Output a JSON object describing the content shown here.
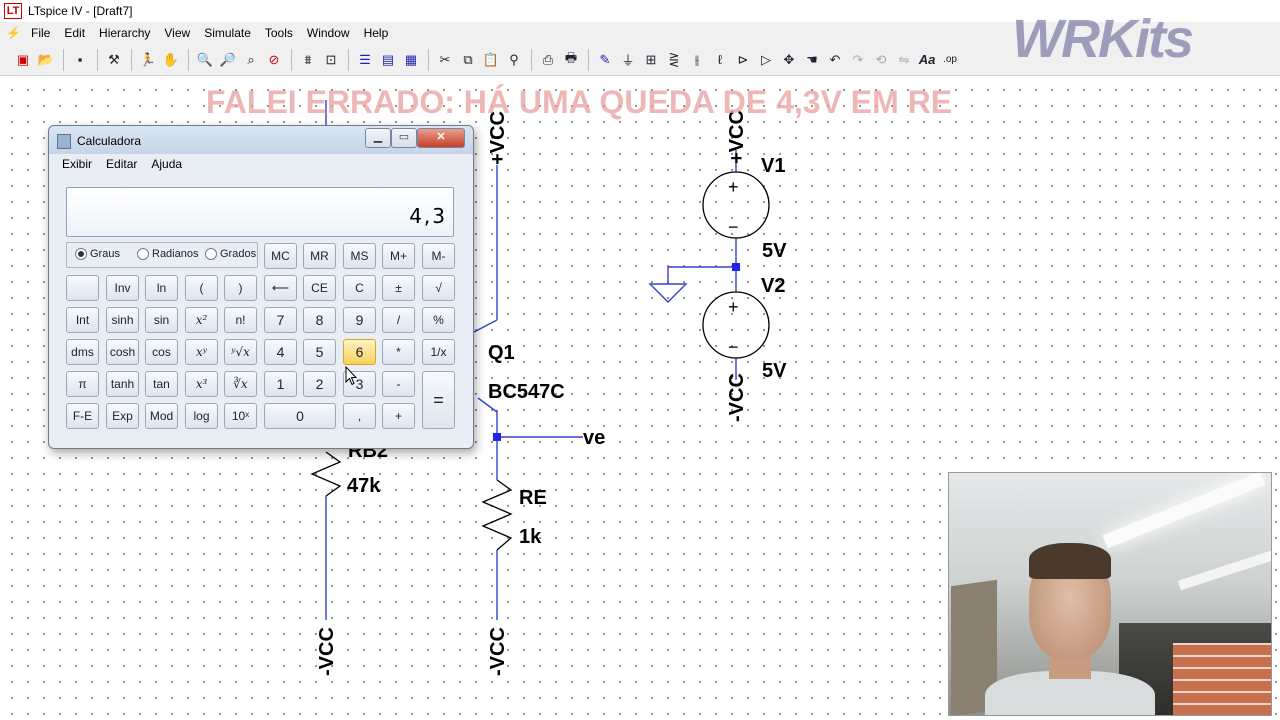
{
  "window": {
    "title": "LTspice IV - [Draft7]",
    "app_icon": "LT"
  },
  "menu": [
    "File",
    "Edit",
    "Hierarchy",
    "View",
    "Simulate",
    "Tools",
    "Window",
    "Help"
  ],
  "toolbar_icons": [
    "new-schematic-icon",
    "open-icon",
    "save-icon",
    "control-panel-icon",
    "run-icon",
    "halt-icon",
    "zoom-in-icon",
    "zoom-out-icon",
    "zoom-fit-icon",
    "zoom-cancel-icon",
    "autorange-icon",
    "tile-icon",
    "horizontal-tile-icon",
    "vertical-tile-icon",
    "cascade-icon",
    "cut-icon",
    "copy-icon",
    "paste-icon",
    "find-icon",
    "print-setup-icon",
    "print-icon",
    "draw-wire-icon",
    "ground-icon",
    "label-net-icon",
    "resistor-icon",
    "capacitor-icon",
    "inductor-icon",
    "diode-icon",
    "component-icon",
    "move-icon",
    "drag-icon",
    "undo-icon",
    "redo-icon",
    "rotate-icon",
    "mirror-icon",
    "text-icon",
    "spice-directive-icon"
  ],
  "watermark": "WRKits",
  "banner": "FALEI ERRADO: HÁ UMA QUEDA DE 4,3V EM RE",
  "schematic": {
    "labels": {
      "vcc_top": "+VCC",
      "vcc_v1": "+VCC",
      "v1": "V1",
      "v1_value": "5V",
      "v2": "V2",
      "v2_value": "5V",
      "vcc_v2": "-VCC",
      "q1": "Q1",
      "q1_model": "BC547C",
      "ve": "ve",
      "rb2": "RB2",
      "rb2_value": "47k",
      "re": "RE",
      "re_value": "1k",
      "vee_left": "-VCC",
      "vee_right": "-VCC",
      "plus": "+",
      "minus": "−"
    },
    "colors": {
      "wire": "#3344cc",
      "node": "#2222ee",
      "component": "#000000"
    }
  },
  "calculator": {
    "title": "Calculadora",
    "menu": [
      "Exibir",
      "Editar",
      "Ajuda"
    ],
    "display": "4,3",
    "angle_modes": [
      {
        "label": "Graus",
        "selected": true
      },
      {
        "label": "Radianos",
        "selected": false
      },
      {
        "label": "Grados",
        "selected": false
      }
    ],
    "memory_keys": [
      "MC",
      "MR",
      "MS",
      "M+",
      "M-"
    ],
    "keys": {
      "inv": "Inv",
      "ln": "ln",
      "lparen": "(",
      "rparen": ")",
      "back": "⟵",
      "ce": "CE",
      "c": "C",
      "pm": "±",
      "sqrt": "√",
      "int": "Int",
      "sinh": "sinh",
      "sin": "sin",
      "x2": "x²",
      "fact": "n!",
      "k7": "7",
      "k8": "8",
      "k9": "9",
      "div": "/",
      "pct": "%",
      "dms": "dms",
      "cosh": "cosh",
      "cos": "cos",
      "xy": "xʸ",
      "yroot": "ʸ√x",
      "k4": "4",
      "k5": "5",
      "k6": "6",
      "mul": "*",
      "recip": "1/x",
      "pi": "π",
      "tanh": "tanh",
      "tan": "tan",
      "x3": "x³",
      "cbrt": "∛x",
      "k1": "1",
      "k2": "2",
      "k3": "3",
      "sub": "-",
      "eq": "=",
      "fe": "F-E",
      "exp": "Exp",
      "mod": "Mod",
      "log": "log",
      "p10": "10ˣ",
      "k0": "0",
      "dot": ",",
      "add": "+"
    }
  }
}
